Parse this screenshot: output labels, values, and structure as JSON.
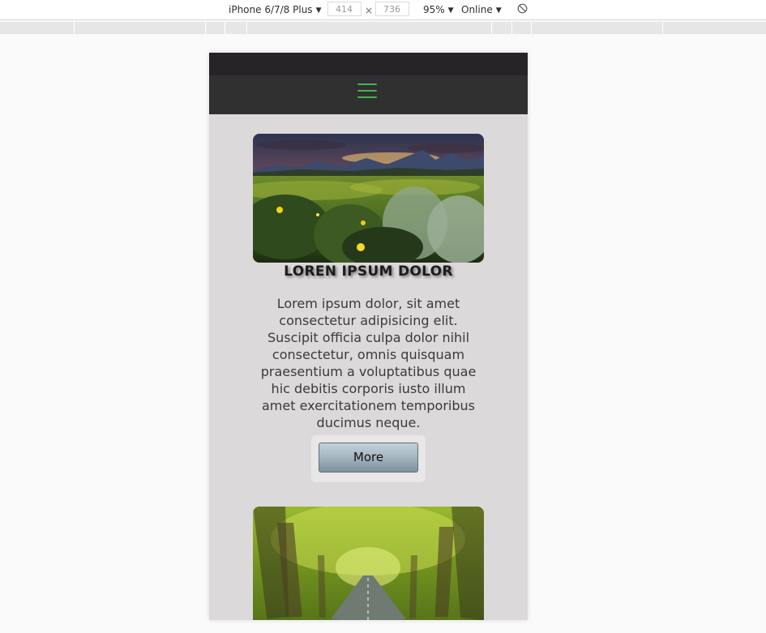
{
  "devtools": {
    "device": "iPhone 6/7/8 Plus",
    "width": "414",
    "height": "736",
    "times": "×",
    "zoom": "95%",
    "network": "Online"
  },
  "nav": {
    "menu_icon": "hamburger-menu-icon",
    "accent": "#4caf50"
  },
  "cards": [
    {
      "image": "mountain-meadow-sunset-photo",
      "title": "LOREN IPSUM DOLOR",
      "text": "Lorem ipsum dolor, sit amet consectetur adipisicing elit. Suscipit officia culpa dolor nihil consectetur, omnis quisquam praesentium a voluptatibus quae hic debitis corporis iusto illum amet exercitationem temporibus ducimus neque.",
      "button": "More"
    },
    {
      "image": "tree-lined-road-photo"
    }
  ]
}
